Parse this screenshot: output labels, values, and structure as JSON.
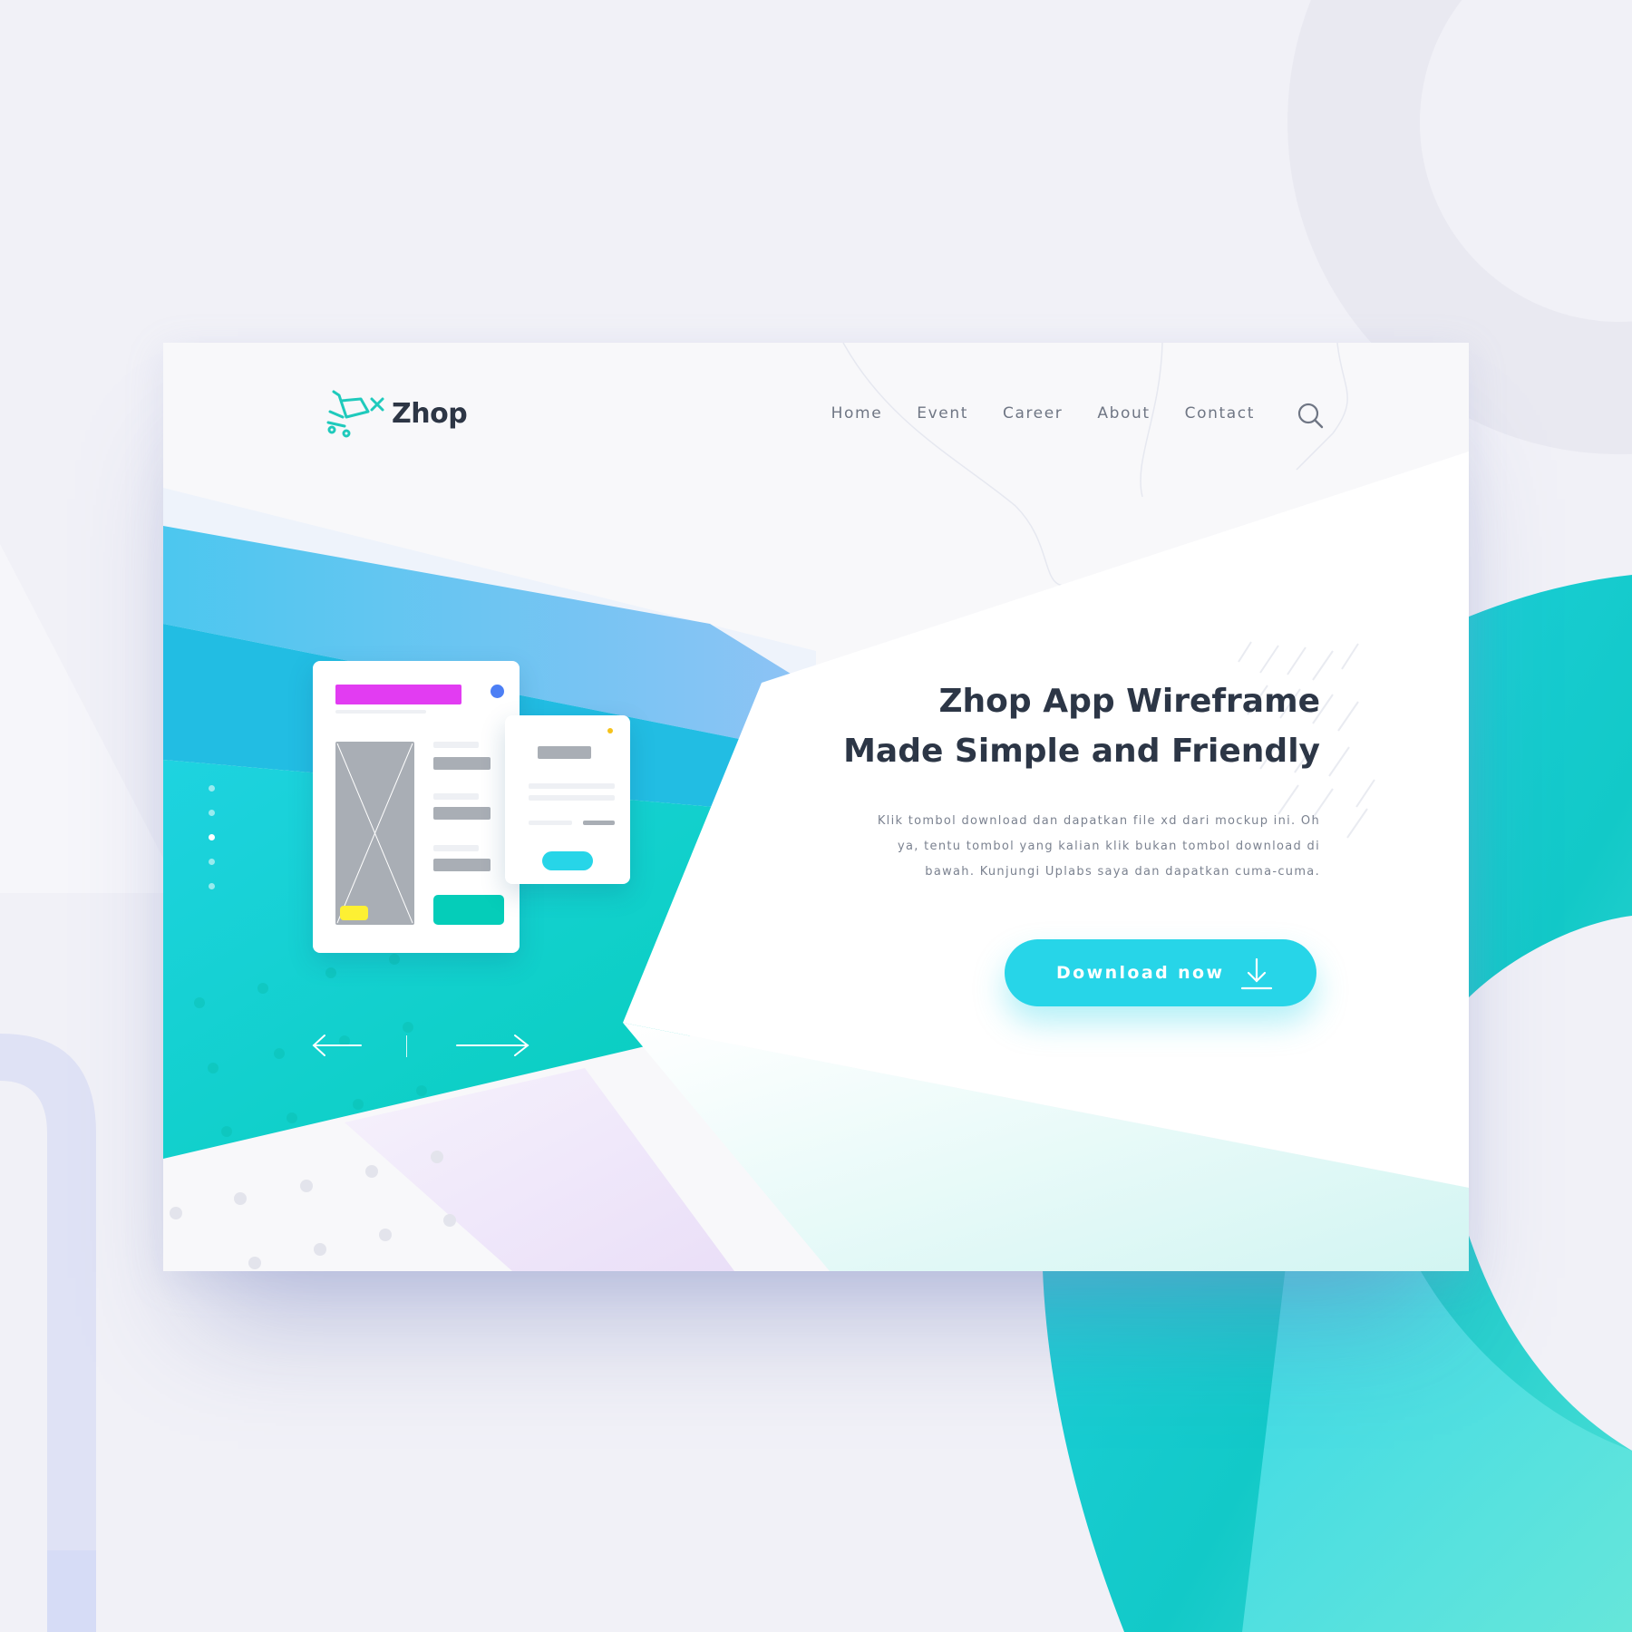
{
  "brand": {
    "name": "Zhop",
    "logo_icon": "shopping-cart-icon",
    "accent_color": "#1fcabc",
    "dark_text_color": "#2d3645"
  },
  "nav": {
    "items": [
      {
        "label": "Home"
      },
      {
        "label": "Event"
      },
      {
        "label": "Career"
      },
      {
        "label": "About"
      },
      {
        "label": "Contact"
      }
    ],
    "search_icon": "search-icon"
  },
  "hero": {
    "title_line1": "Zhop App Wireframe",
    "title_line2": "Made Simple and Friendly",
    "description_line1": "Klik tombol download dan dapatkan file xd dari mockup ini. Oh",
    "description_line2": "ya, tentu tombol yang kalian klik bukan tombol download di",
    "description_line3": "bawah. Kunjungi Uplabs saya dan dapatkan cuma-cuma.",
    "cta_label": "Download now",
    "cta_icon": "download-icon",
    "cta_color": "#27d5e8"
  },
  "slider": {
    "prev_icon": "arrow-left-icon",
    "next_icon": "arrow-right-icon",
    "dot_count": 5,
    "active_dot_index": 2
  },
  "illustration": {
    "main_card_accent": "#e23cf2",
    "status_dot_color": "#4c7ff5",
    "main_card_button_color": "#05cdb9",
    "badge_color": "#fdf033",
    "small_card_button_color": "#27d5e8",
    "small_card_dot_color": "#f5c21b"
  }
}
